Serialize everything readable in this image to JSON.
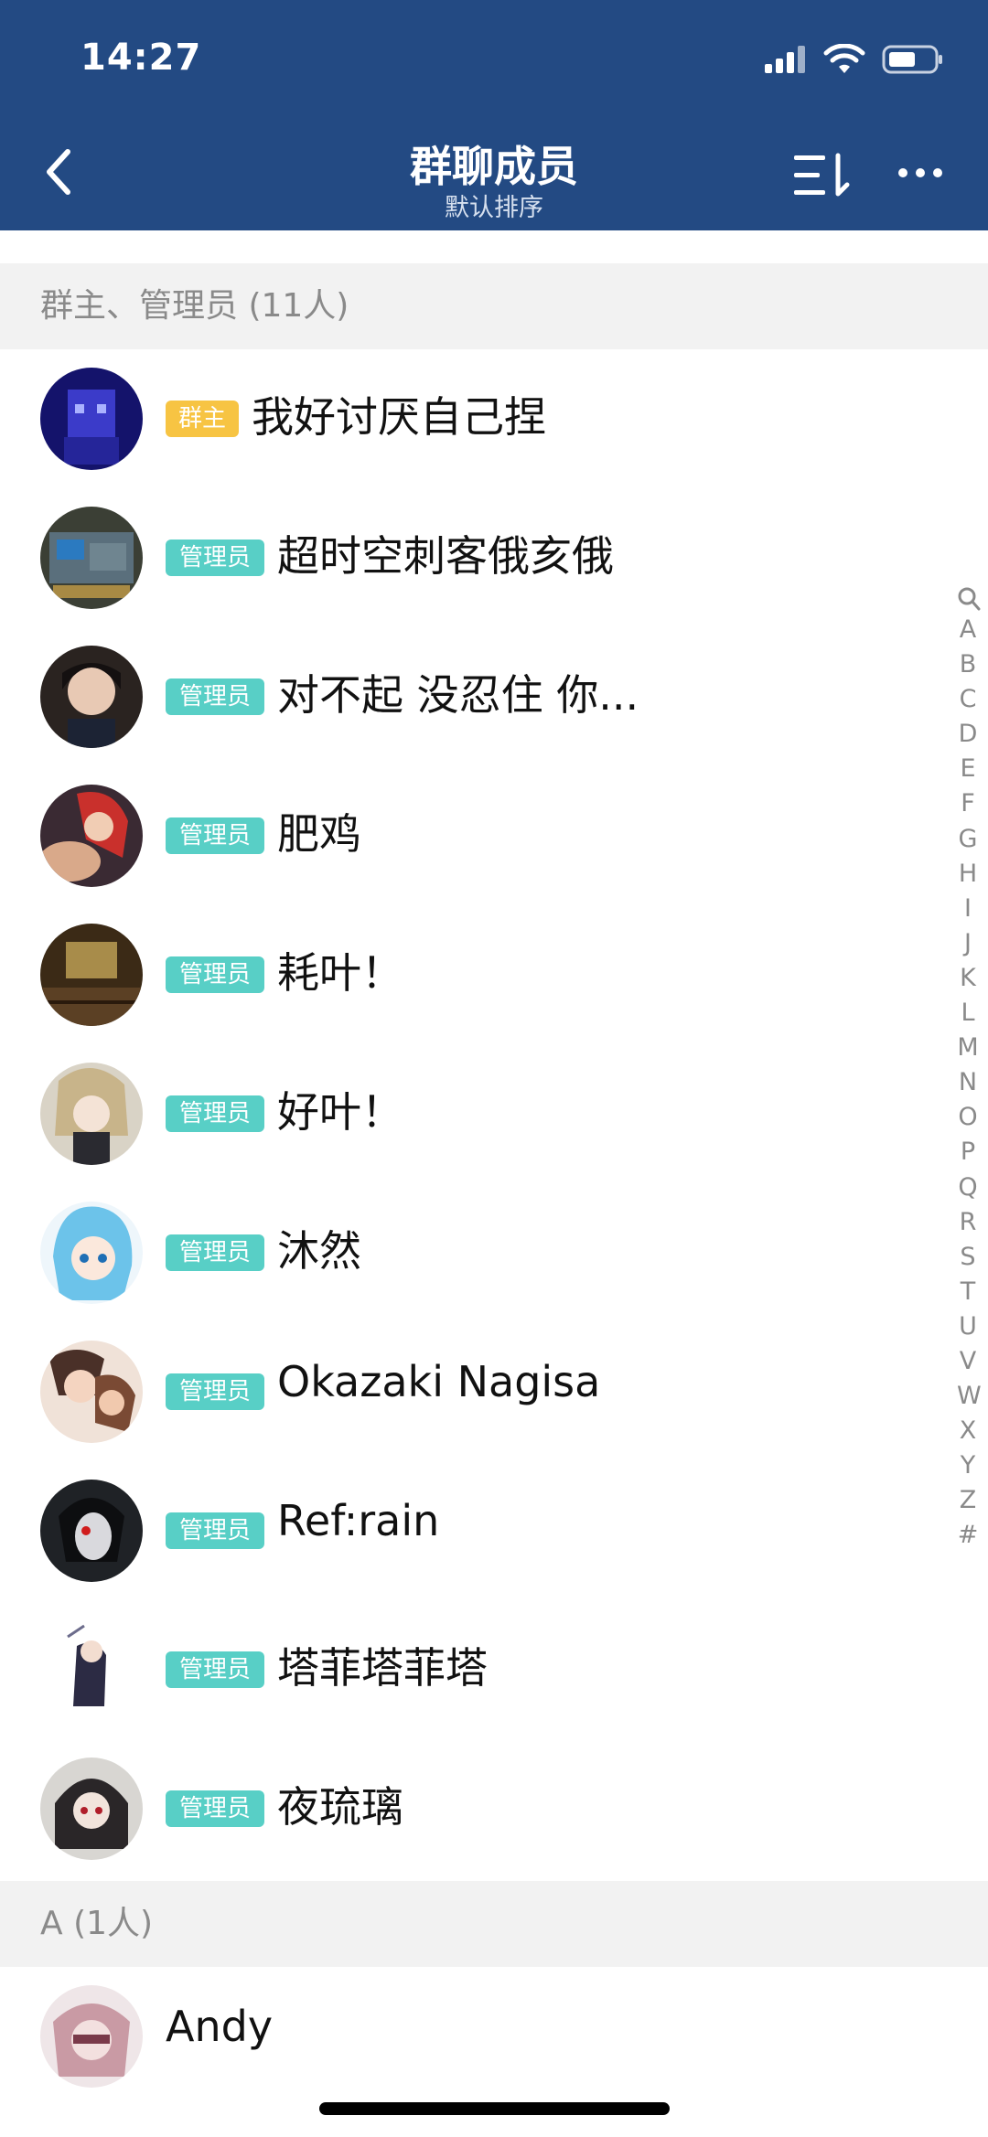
{
  "status": {
    "time": "14:27"
  },
  "header": {
    "title": "群聊成员",
    "subtitle": "默认排序"
  },
  "sections": [
    {
      "label": "群主、管理员 (11人)"
    },
    {
      "label": "A (1人)"
    }
  ],
  "members": [
    {
      "badge": "群主",
      "name": "我好讨厌自己捏"
    },
    {
      "badge": "管理员",
      "name": "超时空刺客俄亥俄"
    },
    {
      "badge": "管理员",
      "name": "对不起 没忍住 你..."
    },
    {
      "badge": "管理员",
      "name": "肥鸡"
    },
    {
      "badge": "管理员",
      "name": "耗叶！"
    },
    {
      "badge": "管理员",
      "name": "好叶！"
    },
    {
      "badge": "管理员",
      "name": "沐然"
    },
    {
      "badge": "管理员",
      "name": "Okazaki Nagisa"
    },
    {
      "badge": "管理员",
      "name": "Ref:rain"
    },
    {
      "badge": "管理员",
      "name": "塔菲塔菲塔"
    },
    {
      "badge": "管理员",
      "name": "夜琉璃"
    },
    {
      "name": "Andy"
    }
  ],
  "index_bar": [
    "A",
    "B",
    "C",
    "D",
    "E",
    "F",
    "G",
    "H",
    "I",
    "J",
    "K",
    "L",
    "M",
    "N",
    "O",
    "P",
    "Q",
    "R",
    "S",
    "T",
    "U",
    "V",
    "W",
    "X",
    "Y",
    "Z",
    "#"
  ],
  "colors": {
    "header_bg": "#234a83",
    "owner_badge": "#f7c443",
    "admin_badge": "#58cfc6",
    "section_bg": "#f2f2f2"
  }
}
